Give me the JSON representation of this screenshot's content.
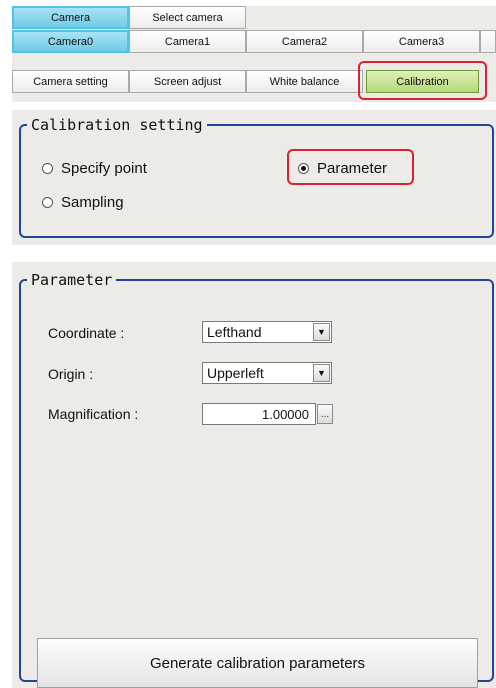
{
  "tabs": {
    "row1": [
      "Camera",
      "Select camera"
    ],
    "row2": [
      "Camera0",
      "Camera1",
      "Camera2",
      "Camera3"
    ],
    "row3": [
      "Camera setting",
      "Screen adjust",
      "White balance",
      "Calibration"
    ]
  },
  "calibration_setting": {
    "title": "Calibration setting",
    "options": {
      "specify_point": "Specify point",
      "parameter": "Parameter",
      "sampling": "Sampling"
    },
    "selected": "Parameter"
  },
  "parameter": {
    "title": "Parameter",
    "coordinate": {
      "label": "Coordinate :",
      "value": "Lefthand"
    },
    "origin": {
      "label": "Origin :",
      "value": "Upperleft"
    },
    "magnification": {
      "label": "Magnification :",
      "value": "1.00000",
      "button": "..."
    },
    "generate_button": "Generate calibration parameters"
  },
  "colors": {
    "selected_tab": "#6fcbe8",
    "calibration_tab": "#b5d87a",
    "highlight": "#d9232f",
    "group_border": "#24449a"
  }
}
